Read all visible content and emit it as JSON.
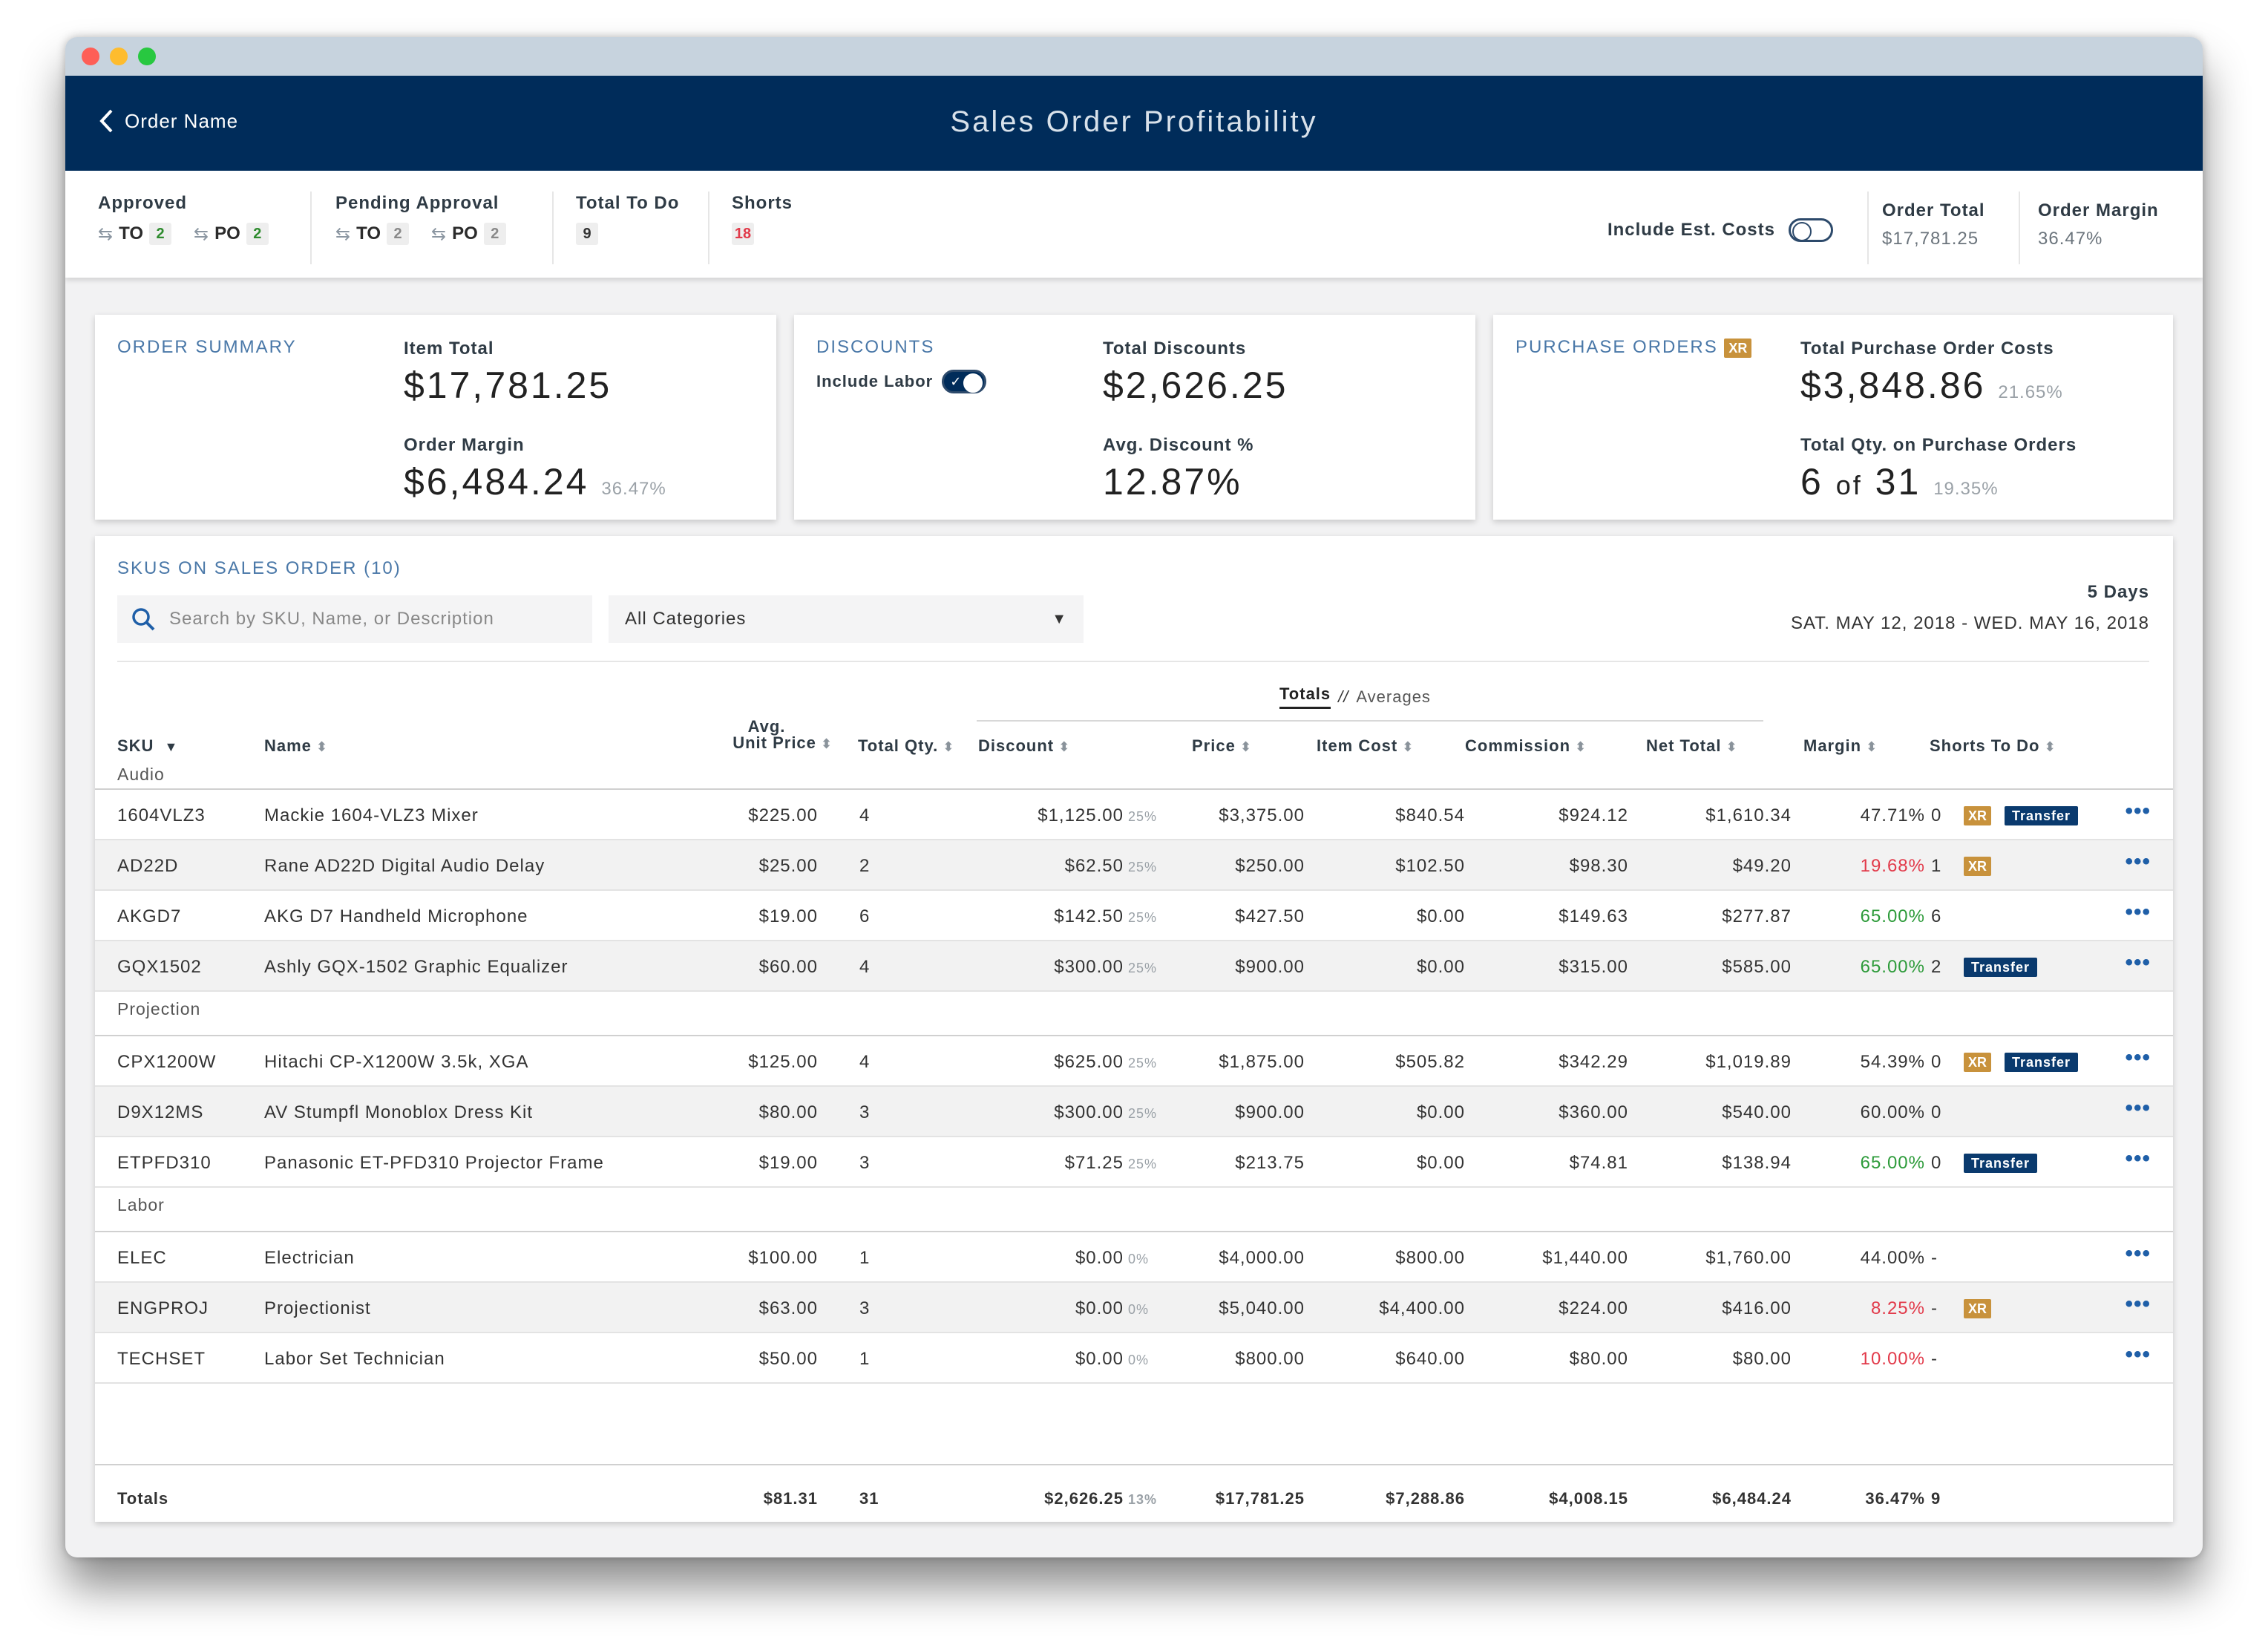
{
  "header": {
    "back_label": "Order Name",
    "title": "Sales Order Profitability"
  },
  "status": {
    "approved": {
      "label": "Approved",
      "to_label": "TO",
      "to_count": "2",
      "po_label": "PO",
      "po_count": "2"
    },
    "pending": {
      "label": "Pending Approval",
      "to_label": "TO",
      "to_count": "2",
      "po_label": "PO",
      "po_count": "2"
    },
    "todo": {
      "label": "Total To Do",
      "count": "9"
    },
    "shorts": {
      "label": "Shorts",
      "count": "18"
    },
    "include_est_costs": "Include Est. Costs",
    "order_total": {
      "label": "Order Total",
      "value": "$17,781.25"
    },
    "order_margin": {
      "label": "Order Margin",
      "value": "36.47%"
    }
  },
  "summary": {
    "title": "ORDER SUMMARY",
    "item_total_label": "Item Total",
    "item_total": "$17,781.25",
    "margin_label": "Order Margin",
    "margin": "$6,484.24",
    "margin_pct": "36.47%"
  },
  "discounts": {
    "title": "DISCOUNTS",
    "include_labor": "Include Labor",
    "total_label": "Total Discounts",
    "total": "$2,626.25",
    "avg_label": "Avg. Discount %",
    "avg": "12.87%"
  },
  "purchase_orders": {
    "title": "PURCHASE ORDERS",
    "badge": "XR",
    "costs_label": "Total Purchase Order Costs",
    "costs": "$3,848.86",
    "costs_pct": "21.65%",
    "qty_label": "Total Qty. on Purchase Orders",
    "qty": "6",
    "qty_of": "of",
    "qty_total": "31",
    "qty_pct": "19.35%"
  },
  "skus": {
    "title": "SKUS ON SALES ORDER (10)",
    "search_placeholder": "Search by SKU, Name, or Description",
    "category": "All Categories",
    "days": "5 Days",
    "date_range": "SAT. MAY 12, 2018 - WED. MAY 16, 2018",
    "view_totals": "Totals",
    "view_sep": "//",
    "view_averages": "Averages"
  },
  "columns": {
    "sku": "SKU",
    "name": "Name",
    "avg1": "Avg.",
    "avg2": "Unit Price",
    "qty": "Total Qty.",
    "discount": "Discount",
    "price": "Price",
    "item_cost": "Item Cost",
    "commission": "Commission",
    "net_total": "Net Total",
    "margin": "Margin",
    "shorts": "Shorts To Do"
  },
  "categories": [
    "Audio",
    "Projection",
    "Labor"
  ],
  "rows": [
    {
      "sku": "1604VLZ3",
      "name": "Mackie 1604-VLZ3 Mixer",
      "unit": "$225.00",
      "qty": "4",
      "disc": "$1,125.00",
      "dpct": "25%",
      "price": "$3,375.00",
      "cost": "$840.54",
      "comm": "$924.12",
      "net": "$1,610.34",
      "margin": "47.71%",
      "mstate": "",
      "shorts": "0",
      "xr": "XR",
      "transfer": "Transfer"
    },
    {
      "sku": "AD22D",
      "name": "Rane AD22D Digital Audio Delay",
      "unit": "$25.00",
      "qty": "2",
      "disc": "$62.50",
      "dpct": "25%",
      "price": "$250.00",
      "cost": "$102.50",
      "comm": "$98.30",
      "net": "$49.20",
      "margin": "19.68%",
      "mstate": "neg",
      "shorts": "1",
      "xr": "XR",
      "transfer": ""
    },
    {
      "sku": "AKGD7",
      "name": "AKG D7 Handheld Microphone",
      "unit": "$19.00",
      "qty": "6",
      "disc": "$142.50",
      "dpct": "25%",
      "price": "$427.50",
      "cost": "$0.00",
      "comm": "$149.63",
      "net": "$277.87",
      "margin": "65.00%",
      "mstate": "pos",
      "shorts": "6",
      "xr": "",
      "transfer": ""
    },
    {
      "sku": "GQX1502",
      "name": "Ashly GQX-1502 Graphic Equalizer",
      "unit": "$60.00",
      "qty": "4",
      "disc": "$300.00",
      "dpct": "25%",
      "price": "$900.00",
      "cost": "$0.00",
      "comm": "$315.00",
      "net": "$585.00",
      "margin": "65.00%",
      "mstate": "pos",
      "shorts": "2",
      "xr": "",
      "transfer": "Transfer"
    },
    {
      "sku": "CPX1200W",
      "name": "Hitachi CP-X1200W 3.5k, XGA",
      "unit": "$125.00",
      "qty": "4",
      "disc": "$625.00",
      "dpct": "25%",
      "price": "$1,875.00",
      "cost": "$505.82",
      "comm": "$342.29",
      "net": "$1,019.89",
      "margin": "54.39%",
      "mstate": "",
      "shorts": "0",
      "xr": "XR",
      "transfer": "Transfer"
    },
    {
      "sku": "D9X12MS",
      "name": "AV Stumpfl Monoblox Dress Kit",
      "unit": "$80.00",
      "qty": "3",
      "disc": "$300.00",
      "dpct": "25%",
      "price": "$900.00",
      "cost": "$0.00",
      "comm": "$360.00",
      "net": "$540.00",
      "margin": "60.00%",
      "mstate": "",
      "shorts": "0",
      "xr": "",
      "transfer": ""
    },
    {
      "sku": "ETPFD310",
      "name": "Panasonic ET-PFD310 Projector Frame",
      "unit": "$19.00",
      "qty": "3",
      "disc": "$71.25",
      "dpct": "25%",
      "price": "$213.75",
      "cost": "$0.00",
      "comm": "$74.81",
      "net": "$138.94",
      "margin": "65.00%",
      "mstate": "pos",
      "shorts": "0",
      "xr": "",
      "transfer": "Transfer"
    },
    {
      "sku": "ELEC",
      "name": "Electrician",
      "unit": "$100.00",
      "qty": "1",
      "disc": "$0.00",
      "dpct": "0%",
      "price": "$4,000.00",
      "cost": "$800.00",
      "comm": "$1,440.00",
      "net": "$1,760.00",
      "margin": "44.00%",
      "mstate": "",
      "shorts": "-",
      "xr": "",
      "transfer": ""
    },
    {
      "sku": "ENGPROJ",
      "name": "Projectionist",
      "unit": "$63.00",
      "qty": "3",
      "disc": "$0.00",
      "dpct": "0%",
      "price": "$5,040.00",
      "cost": "$4,400.00",
      "comm": "$224.00",
      "net": "$416.00",
      "margin": "8.25%",
      "mstate": "neg",
      "shorts": "-",
      "xr": "XR",
      "transfer": ""
    },
    {
      "sku": "TECHSET",
      "name": "Labor Set Technician",
      "unit": "$50.00",
      "qty": "1",
      "disc": "$0.00",
      "dpct": "0%",
      "price": "$800.00",
      "cost": "$640.00",
      "comm": "$80.00",
      "net": "$80.00",
      "margin": "10.00%",
      "mstate": "neg",
      "shorts": "-",
      "xr": "",
      "transfer": ""
    }
  ],
  "totals": {
    "label": "Totals",
    "unit": "$81.31",
    "qty": "31",
    "disc": "$2,626.25",
    "dpct": "13%",
    "price": "$17,781.25",
    "cost": "$7,288.86",
    "comm": "$4,008.15",
    "net": "$6,484.24",
    "margin": "36.47%",
    "shorts": "9"
  },
  "more_label": "•••"
}
